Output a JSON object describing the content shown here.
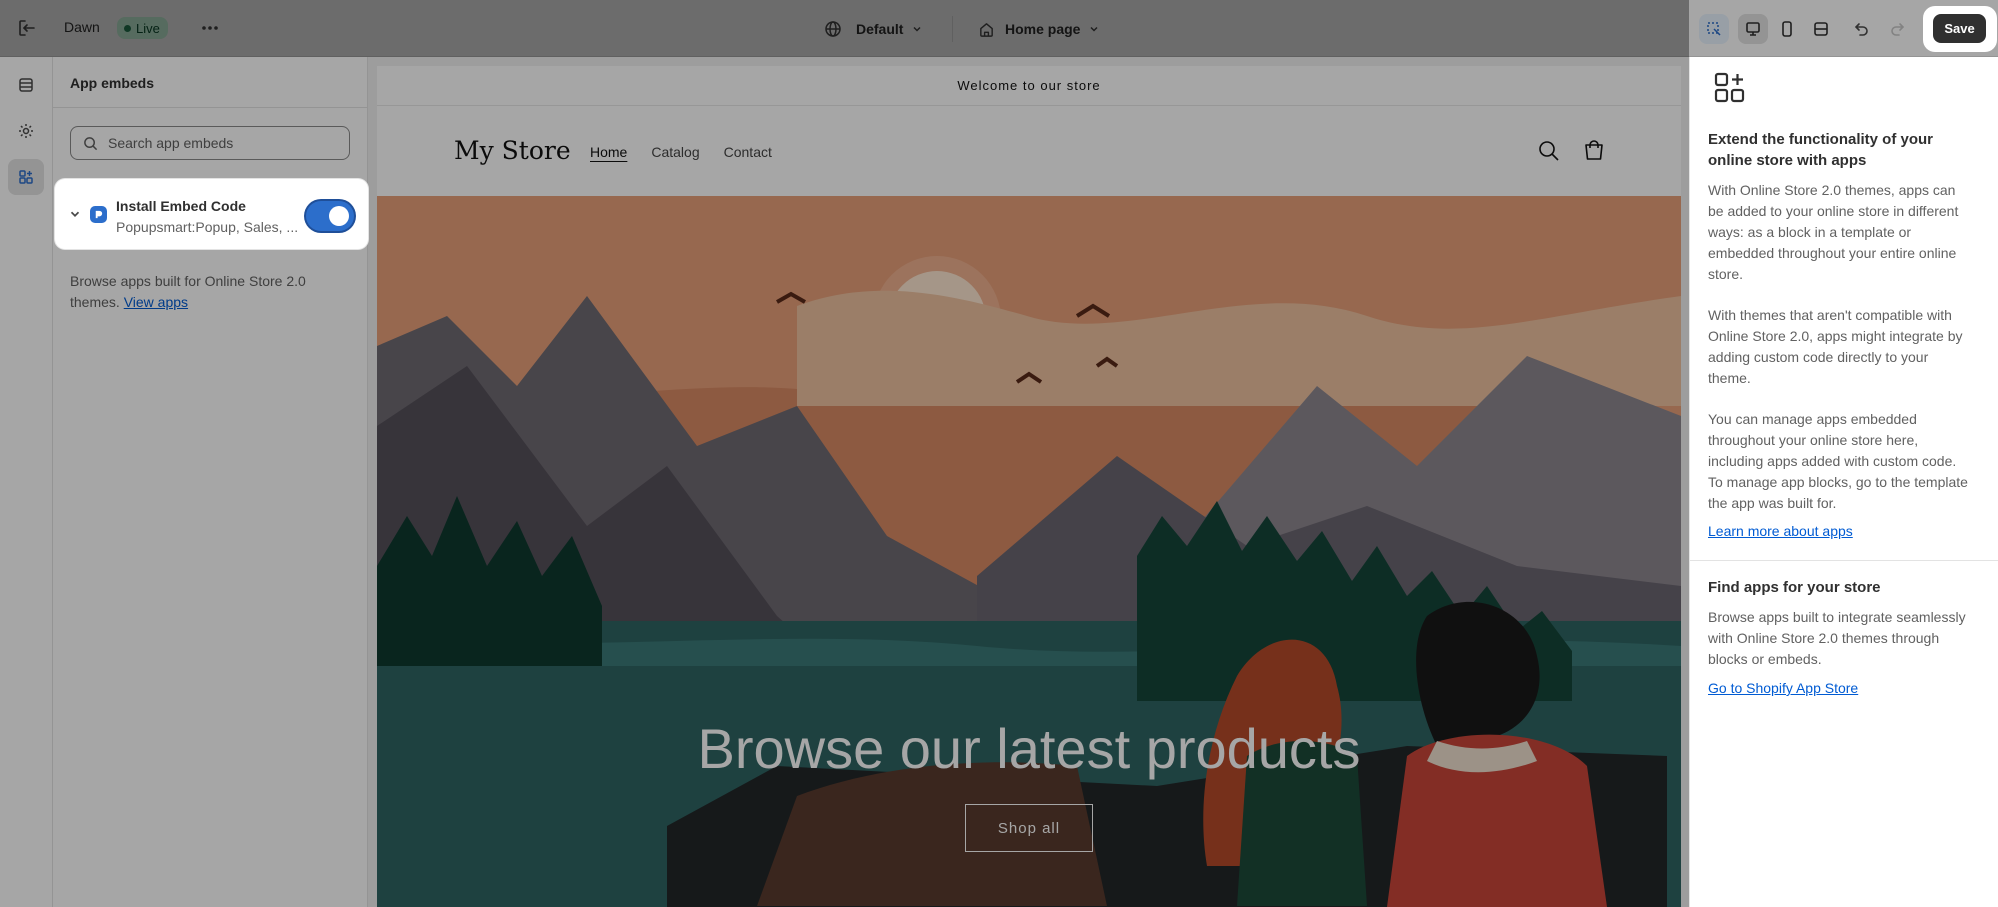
{
  "topbar": {
    "theme_name": "Dawn",
    "status_badge": "Live",
    "theme_selector": "Default",
    "page_selector": "Home page",
    "save_label": "Save",
    "icons": [
      "exit-icon",
      "more-icon",
      "globe-icon",
      "home-icon",
      "chevron-down-icon",
      "inspector-icon",
      "desktop-icon",
      "mobile-icon",
      "fullscreen-icon",
      "undo-icon",
      "redo-icon"
    ]
  },
  "rail": {
    "items": [
      "sections-icon",
      "settings-icon",
      "app-embeds-icon"
    ],
    "active": "app-embeds-icon"
  },
  "panel": {
    "title": "App embeds",
    "search_placeholder": "Search app embeds",
    "embed": {
      "name": "Install Embed Code",
      "subtitle": "Popupsmart:Popup, Sales, ...",
      "enabled": true
    },
    "browse_text": "Browse apps built for Online Store 2.0 themes.",
    "browse_link": "View apps"
  },
  "store": {
    "announcement": "Welcome to our store",
    "logo": "My Store",
    "nav": [
      "Home",
      "Catalog",
      "Contact"
    ],
    "hero_title": "Browse our latest products",
    "hero_button": "Shop all"
  },
  "info": {
    "heading1": "Extend the functionality of your online store with apps",
    "p1": "With Online Store 2.0 themes, apps can be added to your online store in different ways: as a block in a template or embedded throughout your entire online store.",
    "p2": "With themes that aren't compatible with Online Store 2.0, apps might integrate by adding custom code directly to your theme.",
    "p3": "You can manage apps embedded throughout your online store here, including apps added with custom code. To manage app blocks, go to the template the app was built for.",
    "link1": "Learn more about apps",
    "heading2": "Find apps for your store",
    "p4": "Browse apps built to integrate seamlessly with Online Store 2.0 themes through blocks or embeds.",
    "link2": "Go to Shopify App Store"
  },
  "colors": {
    "accent": "#2c6ecb",
    "live": "#29845a",
    "link": "#005bd3"
  }
}
